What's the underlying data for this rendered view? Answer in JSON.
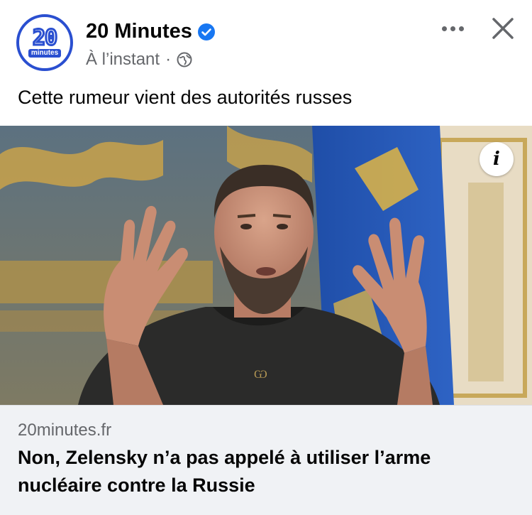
{
  "post": {
    "page": {
      "name": "20 Minutes",
      "verified": true,
      "logo_number": "20",
      "logo_word": "minutes",
      "timestamp": "À l’instant",
      "separator": "·",
      "audience_icon": "globe-icon"
    },
    "actions": {
      "more_icon": "more-horizontal-icon",
      "close_icon": "close-icon"
    },
    "caption": "Cette rumeur vient des autorités russes",
    "image": {
      "info_label": "i",
      "alt": "Volodymyr Zelensky raising both hands in front of a blue flag"
    },
    "link": {
      "domain": "20minutes.fr",
      "title": "Non, Zelensky n’a pas appelé à utiliser l’arme nucléaire contre la Russie"
    }
  },
  "colors": {
    "brand_blue": "#2a4fd0",
    "verified_blue": "#1877f2",
    "secondary_text": "#65676b",
    "link_bg": "#f0f2f5"
  }
}
